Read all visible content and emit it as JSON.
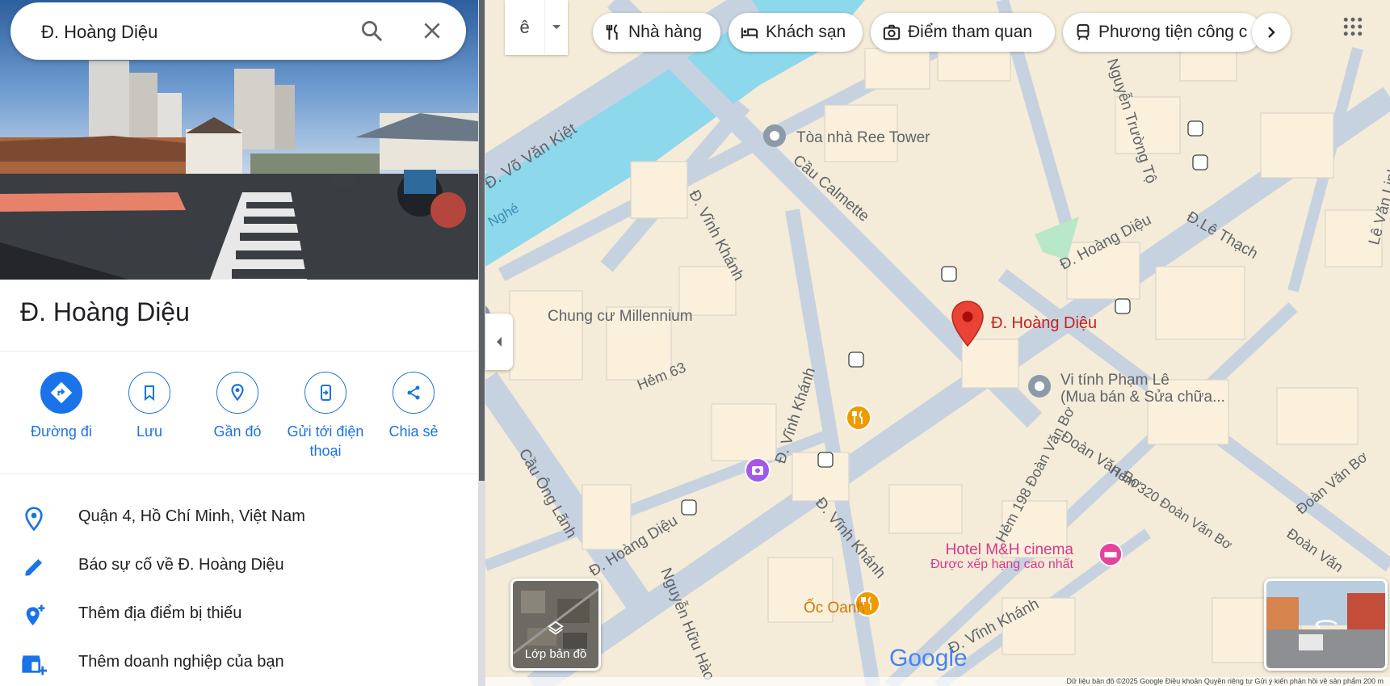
{
  "search": {
    "value": "Đ. Hoàng Diệu"
  },
  "place": {
    "title": "Đ. Hoàng Diệu"
  },
  "actions": [
    {
      "label": "Đường đi",
      "icon": "directions-icon"
    },
    {
      "label": "Lưu",
      "icon": "bookmark-icon"
    },
    {
      "label": "Gần đó",
      "icon": "nearby-icon"
    },
    {
      "label": "Gửi tới điện thoại",
      "icon": "send-to-phone-icon"
    },
    {
      "label": "Chia sẻ",
      "icon": "share-icon"
    }
  ],
  "info": [
    {
      "text": "Quận 4, Hồ Chí Minh, Việt Nam",
      "icon": "location-pin-icon"
    },
    {
      "text": "Báo sự cố về Đ. Hoàng Diệu",
      "icon": "pencil-icon"
    },
    {
      "text": "Thêm địa điểm bị thiếu",
      "icon": "add-place-icon"
    },
    {
      "text": "Thêm doanh nghiệp của bạn",
      "icon": "add-business-icon"
    }
  ],
  "map": {
    "layer_button": "ê",
    "chips": [
      {
        "label": "Nhà hàng",
        "icon": "restaurant-icon"
      },
      {
        "label": "Khách sạn",
        "icon": "hotel-icon"
      },
      {
        "label": "Điểm tham quan",
        "icon": "camera-icon"
      },
      {
        "label": "Phương tiện công c",
        "icon": "transit-icon"
      }
    ],
    "pin_label": "Đ. Hoàng Diệu",
    "pois": {
      "ree": "Tòa nhà Ree Tower",
      "millennium": "Chung cư Millennium",
      "vitinh1": "Vi tính Phạm Lê",
      "vitinh2": "(Mua bán & Sửa chữa...",
      "hotel1": "Hotel M&H cinema",
      "hotel2": "Được xếp hạng cao nhất",
      "ocoanh": "Ốc Oanh"
    },
    "streets": {
      "vovankiet": "Đ. Võ Văn Kiệt",
      "calmette": "Cầu Calmette",
      "vinhkhanh1": "Đ. Vĩnh Khánh",
      "vinhkhanh2": "Đ. Vĩnh Khánh",
      "vinhkhanh3": "Đ. Vĩnh Khánh",
      "vinhkhanh4": "Đ. Vĩnh Khánh",
      "hoangdieu1": "Đ. Hoàng Diệu",
      "hoangdieu2": "Đ. Hoàng Diệu",
      "lethach": "Đ.Lê Thạch",
      "nguyentruongto": "Nguyễn Trường Tộ",
      "levanlinh": "Lê Văn Linh",
      "hem63": "Hẻm 63",
      "caulanh": "Cầu Ông Lãnh",
      "doanvanbo": "Đoàn Văn Bơ",
      "hem198": "Hẻm 198 Đoàn Văn Bơ",
      "hem320": "Hẻm 320 Đoàn Văn Bơ",
      "doanvanbo2": "Đoàn Văn",
      "doanvanbo3": "Đoàn Văn Bơ",
      "nguyenhuuhao": "Nguyễn Hữu Hào",
      "nghe": "Nghé"
    },
    "layers_label": "Lớp bản đồ",
    "logo": "Google",
    "footer": "Dữ liệu bản đồ ©2025 Google   Điều khoản   Quyền riêng tư   Gửi ý kiến phản hồi về sản phẩm   200 m"
  },
  "colors": {
    "accent": "#1a73e8",
    "water": "#8ed8ec",
    "pin": "#ea4335",
    "restaurant": "#f29900",
    "hotel": "#e8439c",
    "attraction": "#a259e6"
  }
}
